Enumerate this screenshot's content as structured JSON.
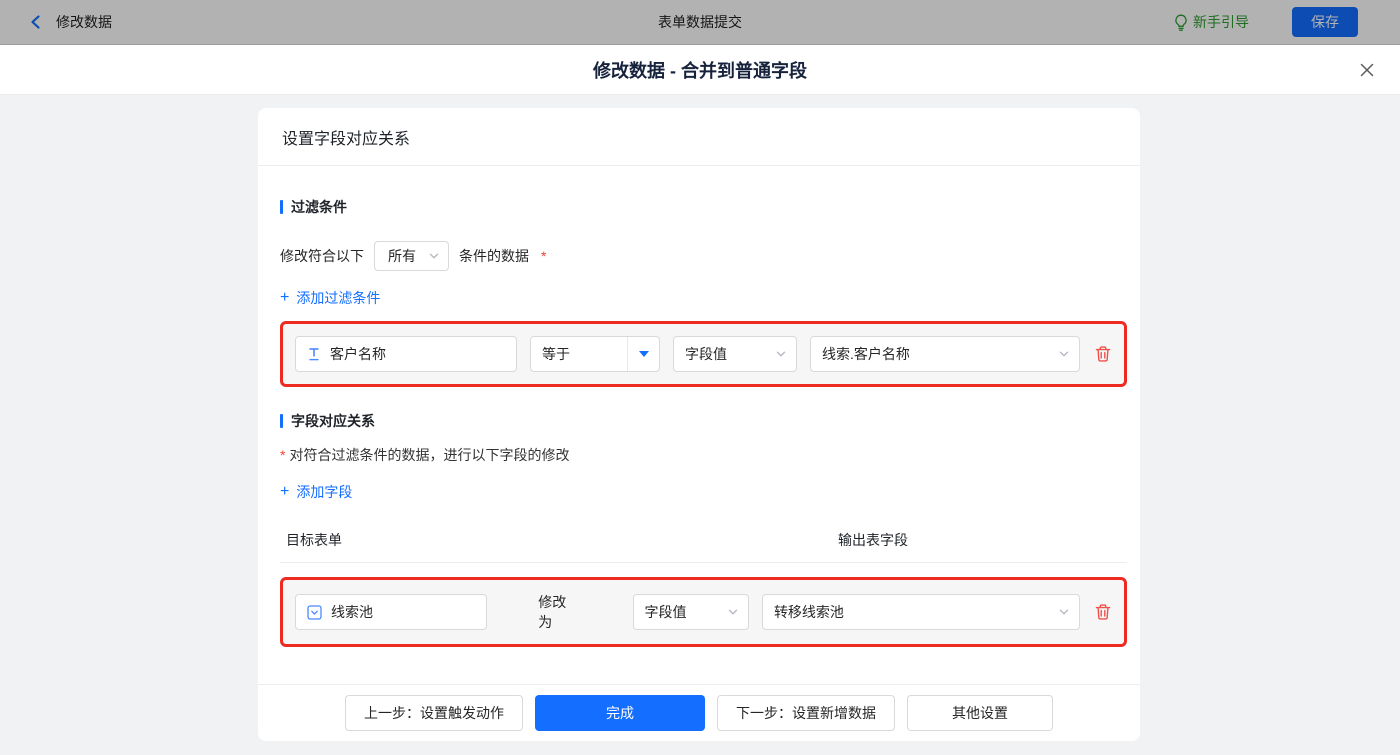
{
  "colors": {
    "accent": "#146eff",
    "danger_border": "#ee2b20",
    "trash": "#f0524a",
    "guide_green": "#2f9e32"
  },
  "topbar": {
    "back_label": "修改数据",
    "center_title": "表单数据提交",
    "guide_label": "新手引导",
    "save_label": "保存"
  },
  "modal": {
    "title": "修改数据 - 合并到普通字段"
  },
  "panel": {
    "header": "设置字段对应关系"
  },
  "filter": {
    "section_title": "过滤条件",
    "cond_prefix": "修改符合以下",
    "cond_select_value": "所有",
    "cond_suffix": "条件的数据",
    "required_mark": "*",
    "add_label": "添加过滤条件",
    "plus": "+",
    "row": {
      "field": "客户名称",
      "operator": "等于",
      "value_type": "字段值",
      "value": "线索.客户名称"
    }
  },
  "mapping": {
    "section_title": "字段对应关系",
    "required_mark": "*",
    "description": "对符合过滤条件的数据，进行以下字段的修改",
    "add_label": "添加字段",
    "plus": "+",
    "col_target": "目标表单",
    "col_output": "输出表字段",
    "row": {
      "field": "线索池",
      "action": "修改为",
      "value_type": "字段值",
      "value": "转移线索池"
    }
  },
  "footer": {
    "prev": "上一步：设置触发动作",
    "done": "完成",
    "next": "下一步：设置新增数据",
    "other": "其他设置"
  }
}
